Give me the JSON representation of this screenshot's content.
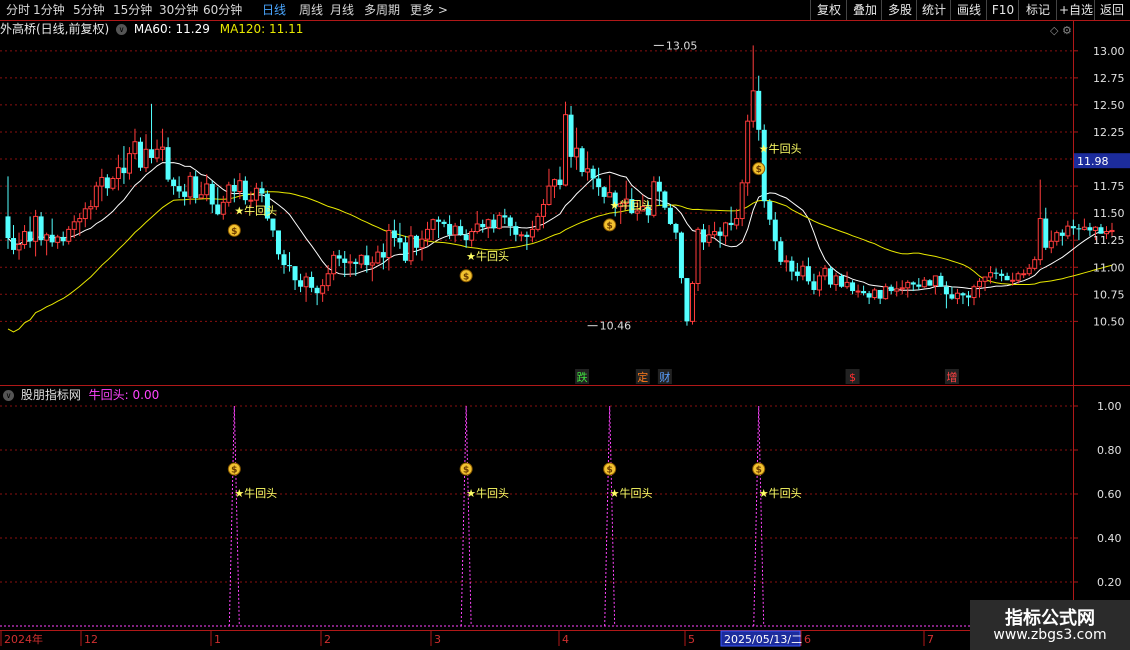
{
  "toolbar": {
    "timeframes": [
      "分时",
      "1分钟",
      "5分钟",
      "15分钟",
      "30分钟",
      "60分钟",
      "日线",
      "周线",
      "月线",
      "多周期",
      "更多 >"
    ],
    "active_timeframe": "日线",
    "buttons": [
      "复权",
      "叠加",
      "多股",
      "统计",
      "画线",
      "F10",
      "标记",
      "+自选",
      "返回"
    ]
  },
  "main_legend": {
    "stock": "外高桥(日线,前复权)",
    "ma60_label": "MA60: 11.29",
    "ma120_label": "MA120: 11.11"
  },
  "sub_legend": {
    "name": "股朋指标网",
    "indicator_label": "牛回头: 0.00"
  },
  "colors": {
    "up": "#ff3c3c",
    "down": "#54ffff",
    "ma_white": "#ffffff",
    "ma_yellow": "#e8e800",
    "grid": "#8a1010",
    "axis": "#b01818",
    "indicator": "#ff44ff",
    "signal_text": "#ffff66",
    "date_highlight_bg": "#1c2c9c"
  },
  "right_axis": {
    "main_ticks": [
      "13.00",
      "12.75",
      "12.50",
      "12.25",
      "11.75",
      "11.50",
      "11.25",
      "11.00",
      "10.75",
      "10.50"
    ],
    "current_price": "11.98",
    "sub_ticks": [
      "1.00",
      "0.80",
      "0.60",
      "0.40",
      "0.20"
    ]
  },
  "annotations": {
    "high_label": "13.05",
    "low_label": "10.46",
    "signal_label": "★牛回头",
    "money_icon": "money-bag-icon",
    "event_tags": [
      {
        "text": "跌",
        "color": "#3fe03f"
      },
      {
        "text": "定",
        "color": "#ff7a1a"
      },
      {
        "text": "财",
        "color": "#5aa0ff"
      },
      {
        "text": "$",
        "color": "#ff3030"
      },
      {
        "text": "增",
        "color": "#ff4444"
      }
    ]
  },
  "bottom_axis": {
    "labels": [
      "2024年",
      "12",
      "1",
      "2",
      "3",
      "4",
      "5",
      "6",
      "7"
    ],
    "cursor_date": "2025/05/13/二"
  },
  "watermark": {
    "title": "指标公式网",
    "url": "www.zbgs3.com"
  },
  "chart_data": {
    "type": "candlestick",
    "ylim": [
      10.3,
      13.1
    ],
    "signal_bars": [
      41,
      83,
      109,
      136
    ],
    "ohlc": [
      [
        11.47,
        11.84,
        11.17,
        11.27
      ],
      [
        11.27,
        11.39,
        11.12,
        11.16
      ],
      [
        11.16,
        11.32,
        11.07,
        11.21
      ],
      [
        11.21,
        11.39,
        11.17,
        11.33
      ],
      [
        11.33,
        11.47,
        11.18,
        11.24
      ],
      [
        11.24,
        11.53,
        11.1,
        11.47
      ],
      [
        11.47,
        11.51,
        11.2,
        11.25
      ],
      [
        11.25,
        11.32,
        11.11,
        11.3
      ],
      [
        11.3,
        11.45,
        11.19,
        11.23
      ],
      [
        11.23,
        11.3,
        11.17,
        11.28
      ],
      [
        11.28,
        11.33,
        11.2,
        11.24
      ],
      [
        11.24,
        11.38,
        11.21,
        11.35
      ],
      [
        11.35,
        11.48,
        11.27,
        11.42
      ],
      [
        11.42,
        11.5,
        11.29,
        11.45
      ],
      [
        11.45,
        11.6,
        11.37,
        11.54
      ],
      [
        11.54,
        11.62,
        11.44,
        11.56
      ],
      [
        11.56,
        11.79,
        11.53,
        11.75
      ],
      [
        11.75,
        11.91,
        11.61,
        11.83
      ],
      [
        11.83,
        11.86,
        11.66,
        11.73
      ],
      [
        11.73,
        11.84,
        11.71,
        11.82
      ],
      [
        11.82,
        12.04,
        11.71,
        11.92
      ],
      [
        11.92,
        12.12,
        11.77,
        11.87
      ],
      [
        11.87,
        12.11,
        11.81,
        12.05
      ],
      [
        12.05,
        12.28,
        12.0,
        12.16
      ],
      [
        12.16,
        12.2,
        11.89,
        11.92
      ],
      [
        11.92,
        12.23,
        11.88,
        12.09
      ],
      [
        12.09,
        12.51,
        11.96,
        12.01
      ],
      [
        12.01,
        12.18,
        11.97,
        12.09
      ],
      [
        12.09,
        12.28,
        11.98,
        12.11
      ],
      [
        12.11,
        12.2,
        11.79,
        11.81
      ],
      [
        11.81,
        11.83,
        11.67,
        11.75
      ],
      [
        11.75,
        11.84,
        11.64,
        11.7
      ],
      [
        11.7,
        11.77,
        11.57,
        11.65
      ],
      [
        11.65,
        11.88,
        11.58,
        11.84
      ],
      [
        11.84,
        11.89,
        11.59,
        11.64
      ],
      [
        11.64,
        11.79,
        11.63,
        11.67
      ],
      [
        11.67,
        11.86,
        11.61,
        11.77
      ],
      [
        11.77,
        11.8,
        11.5,
        11.58
      ],
      [
        11.58,
        11.74,
        11.48,
        11.49
      ],
      [
        11.49,
        11.66,
        11.44,
        11.6
      ],
      [
        11.6,
        11.79,
        11.56,
        11.76
      ],
      [
        11.76,
        11.82,
        11.6,
        11.7
      ],
      [
        11.7,
        11.87,
        11.63,
        11.8
      ],
      [
        11.8,
        11.84,
        11.58,
        11.62
      ],
      [
        11.62,
        11.7,
        11.55,
        11.62
      ],
      [
        11.62,
        11.78,
        11.56,
        11.73
      ],
      [
        11.73,
        11.79,
        11.6,
        11.68
      ],
      [
        11.68,
        11.71,
        11.43,
        11.45
      ],
      [
        11.45,
        11.45,
        11.28,
        11.34
      ],
      [
        11.34,
        11.34,
        11.07,
        11.12
      ],
      [
        11.12,
        11.16,
        10.94,
        11.02
      ],
      [
        11.02,
        11.14,
        10.96,
        11.01
      ],
      [
        11.01,
        11.01,
        10.79,
        10.88
      ],
      [
        10.88,
        10.94,
        10.77,
        10.82
      ],
      [
        10.82,
        10.95,
        10.68,
        10.91
      ],
      [
        10.91,
        10.96,
        10.77,
        10.81
      ],
      [
        10.81,
        10.83,
        10.65,
        10.76
      ],
      [
        10.76,
        10.89,
        10.68,
        10.83
      ],
      [
        10.83,
        11.02,
        10.78,
        10.94
      ],
      [
        10.94,
        11.15,
        10.88,
        11.11
      ],
      [
        11.11,
        11.16,
        11.01,
        11.08
      ],
      [
        11.08,
        11.15,
        10.91,
        11.04
      ],
      [
        11.04,
        11.12,
        10.91,
        11.05
      ],
      [
        11.05,
        11.08,
        10.92,
        11.03
      ],
      [
        11.03,
        11.12,
        10.99,
        11.11
      ],
      [
        11.11,
        11.2,
        10.95,
        11.02
      ],
      [
        11.02,
        11.1,
        10.87,
        11.04
      ],
      [
        11.04,
        11.2,
        11.03,
        11.14
      ],
      [
        11.14,
        11.22,
        10.98,
        11.09
      ],
      [
        11.09,
        11.4,
        10.97,
        11.34
      ],
      [
        11.34,
        11.44,
        11.19,
        11.27
      ],
      [
        11.27,
        11.41,
        11.17,
        11.23
      ],
      [
        11.23,
        11.29,
        11.04,
        11.06
      ],
      [
        11.06,
        11.38,
        11.02,
        11.29
      ],
      [
        11.29,
        11.3,
        11.11,
        11.18
      ],
      [
        11.18,
        11.34,
        11.06,
        11.26
      ],
      [
        11.26,
        11.42,
        11.2,
        11.35
      ],
      [
        11.35,
        11.45,
        11.25,
        11.44
      ],
      [
        11.44,
        11.47,
        11.27,
        11.42
      ],
      [
        11.42,
        11.44,
        11.37,
        11.4
      ],
      [
        11.4,
        11.48,
        11.26,
        11.3
      ],
      [
        11.3,
        11.41,
        11.23,
        11.38
      ],
      [
        11.38,
        11.44,
        11.29,
        11.3
      ],
      [
        11.3,
        11.35,
        11.18,
        11.25
      ],
      [
        11.25,
        11.36,
        11.19,
        11.33
      ],
      [
        11.33,
        11.52,
        11.31,
        11.4
      ],
      [
        11.4,
        11.44,
        11.32,
        11.37
      ],
      [
        11.37,
        11.45,
        11.27,
        11.44
      ],
      [
        11.44,
        11.49,
        11.32,
        11.36
      ],
      [
        11.36,
        11.51,
        11.35,
        11.48
      ],
      [
        11.48,
        11.54,
        11.4,
        11.46
      ],
      [
        11.46,
        11.48,
        11.29,
        11.38
      ],
      [
        11.38,
        11.42,
        11.24,
        11.3
      ],
      [
        11.3,
        11.33,
        11.24,
        11.3
      ],
      [
        11.3,
        11.33,
        11.16,
        11.28
      ],
      [
        11.28,
        11.43,
        11.23,
        11.35
      ],
      [
        11.35,
        11.5,
        11.33,
        11.47
      ],
      [
        11.47,
        11.63,
        11.36,
        11.58
      ],
      [
        11.58,
        11.91,
        11.57,
        11.75
      ],
      [
        11.75,
        11.82,
        11.64,
        11.81
      ],
      [
        11.81,
        11.93,
        11.72,
        11.76
      ],
      [
        11.76,
        12.53,
        11.75,
        12.41
      ],
      [
        12.41,
        12.49,
        11.92,
        12.02
      ],
      [
        12.02,
        12.29,
        11.9,
        12.1
      ],
      [
        12.1,
        12.12,
        11.84,
        11.88
      ],
      [
        11.88,
        12.07,
        11.8,
        11.91
      ],
      [
        11.91,
        11.94,
        11.72,
        11.82
      ],
      [
        11.82,
        11.92,
        11.66,
        11.74
      ],
      [
        11.74,
        11.75,
        11.59,
        11.65
      ],
      [
        11.65,
        11.85,
        11.65,
        11.69
      ],
      [
        11.69,
        11.71,
        11.47,
        11.56
      ],
      [
        11.56,
        11.61,
        11.4,
        11.59
      ],
      [
        11.59,
        11.8,
        11.54,
        11.63
      ],
      [
        11.63,
        11.73,
        11.49,
        11.5
      ],
      [
        11.5,
        11.62,
        11.43,
        11.52
      ],
      [
        11.52,
        11.67,
        11.52,
        11.56
      ],
      [
        11.56,
        11.61,
        11.41,
        11.48
      ],
      [
        11.48,
        11.84,
        11.46,
        11.79
      ],
      [
        11.79,
        11.84,
        11.57,
        11.7
      ],
      [
        11.7,
        11.71,
        11.53,
        11.55
      ],
      [
        11.55,
        11.58,
        11.39,
        11.4
      ],
      [
        11.4,
        11.41,
        11.26,
        11.32
      ],
      [
        11.32,
        11.33,
        10.85,
        10.9
      ],
      [
        10.9,
        10.9,
        10.46,
        10.5
      ],
      [
        10.5,
        10.87,
        10.47,
        10.85
      ],
      [
        10.85,
        11.37,
        10.78,
        11.35
      ],
      [
        11.35,
        11.4,
        11.16,
        11.23
      ],
      [
        11.23,
        11.39,
        11.19,
        11.3
      ],
      [
        11.3,
        11.42,
        11.27,
        11.33
      ],
      [
        11.33,
        11.37,
        11.18,
        11.29
      ],
      [
        11.29,
        11.42,
        11.21,
        11.41
      ],
      [
        11.41,
        11.56,
        11.34,
        11.39
      ],
      [
        11.39,
        11.54,
        11.35,
        11.45
      ],
      [
        11.45,
        11.81,
        11.38,
        11.78
      ],
      [
        11.78,
        12.41,
        11.66,
        12.35
      ],
      [
        12.35,
        13.05,
        12.29,
        12.63
      ],
      [
        12.63,
        12.77,
        12.17,
        12.27
      ],
      [
        12.27,
        12.32,
        11.55,
        11.61
      ],
      [
        11.61,
        11.63,
        11.39,
        11.44
      ],
      [
        11.44,
        11.51,
        11.16,
        11.24
      ],
      [
        11.24,
        11.28,
        11.02,
        11.05
      ],
      [
        11.05,
        11.11,
        10.96,
        11.06
      ],
      [
        11.06,
        11.1,
        10.88,
        10.96
      ],
      [
        10.96,
        11.04,
        10.87,
        10.92
      ],
      [
        10.92,
        11.06,
        10.88,
        11.01
      ],
      [
        11.01,
        11.09,
        10.84,
        10.87
      ],
      [
        10.87,
        10.94,
        10.75,
        10.79
      ],
      [
        10.79,
        10.96,
        10.73,
        10.92
      ],
      [
        10.92,
        11.02,
        10.88,
        10.99
      ],
      [
        10.99,
        11.01,
        10.81,
        10.84
      ],
      [
        10.84,
        10.95,
        10.78,
        10.92
      ],
      [
        10.92,
        10.94,
        10.81,
        10.82
      ],
      [
        10.82,
        10.96,
        10.8,
        10.86
      ],
      [
        10.86,
        10.88,
        10.75,
        10.78
      ],
      [
        10.78,
        10.84,
        10.72,
        10.78
      ],
      [
        10.78,
        10.83,
        10.74,
        10.76
      ],
      [
        10.76,
        10.78,
        10.66,
        10.72
      ],
      [
        10.72,
        10.81,
        10.7,
        10.79
      ],
      [
        10.79,
        10.79,
        10.66,
        10.71
      ],
      [
        10.71,
        10.85,
        10.7,
        10.82
      ],
      [
        10.82,
        10.84,
        10.75,
        10.78
      ],
      [
        10.78,
        10.87,
        10.73,
        10.8
      ],
      [
        10.8,
        10.88,
        10.75,
        10.81
      ],
      [
        10.81,
        10.88,
        10.72,
        10.86
      ],
      [
        10.86,
        10.87,
        10.78,
        10.84
      ],
      [
        10.84,
        10.9,
        10.79,
        10.82
      ],
      [
        10.82,
        10.91,
        10.81,
        10.88
      ],
      [
        10.88,
        10.89,
        10.83,
        10.83
      ],
      [
        10.83,
        10.92,
        10.75,
        10.92
      ],
      [
        10.92,
        10.95,
        10.82,
        10.82
      ],
      [
        10.82,
        10.87,
        10.62,
        10.75
      ],
      [
        10.75,
        10.82,
        10.7,
        10.71
      ],
      [
        10.71,
        10.8,
        10.66,
        10.76
      ],
      [
        10.76,
        10.77,
        10.66,
        10.74
      ],
      [
        10.74,
        10.78,
        10.64,
        10.72
      ],
      [
        10.72,
        10.84,
        10.65,
        10.82
      ],
      [
        10.82,
        10.9,
        10.72,
        10.87
      ],
      [
        10.87,
        10.91,
        10.78,
        10.91
      ],
      [
        10.91,
        11.01,
        10.85,
        10.95
      ],
      [
        10.95,
        10.99,
        10.89,
        10.94
      ],
      [
        10.94,
        10.98,
        10.87,
        10.92
      ],
      [
        10.92,
        10.95,
        10.88,
        10.88
      ],
      [
        10.88,
        10.95,
        10.83,
        10.88
      ],
      [
        10.88,
        10.96,
        10.85,
        10.94
      ],
      [
        10.94,
        10.98,
        10.9,
        10.94
      ],
      [
        10.94,
        11.03,
        10.92,
        10.99
      ],
      [
        10.99,
        11.1,
        10.97,
        11.07
      ],
      [
        11.07,
        11.81,
        11.02,
        11.45
      ],
      [
        11.45,
        11.55,
        11.16,
        11.18
      ],
      [
        11.18,
        11.34,
        11.13,
        11.24
      ],
      [
        11.24,
        11.34,
        11.2,
        11.32
      ],
      [
        11.32,
        11.35,
        11.2,
        11.29
      ],
      [
        11.29,
        11.43,
        11.26,
        11.38
      ],
      [
        11.38,
        11.44,
        11.3,
        11.36
      ],
      [
        11.36,
        11.4,
        11.25,
        11.35
      ],
      [
        11.35,
        11.45,
        11.34,
        11.37
      ],
      [
        11.37,
        11.41,
        11.29,
        11.34
      ],
      [
        11.34,
        11.38,
        11.25,
        11.37
      ],
      [
        11.37,
        11.4,
        11.31,
        11.31
      ],
      [
        11.31,
        11.38,
        11.26,
        11.33
      ],
      [
        11.33,
        11.41,
        11.29,
        11.34
      ]
    ]
  }
}
